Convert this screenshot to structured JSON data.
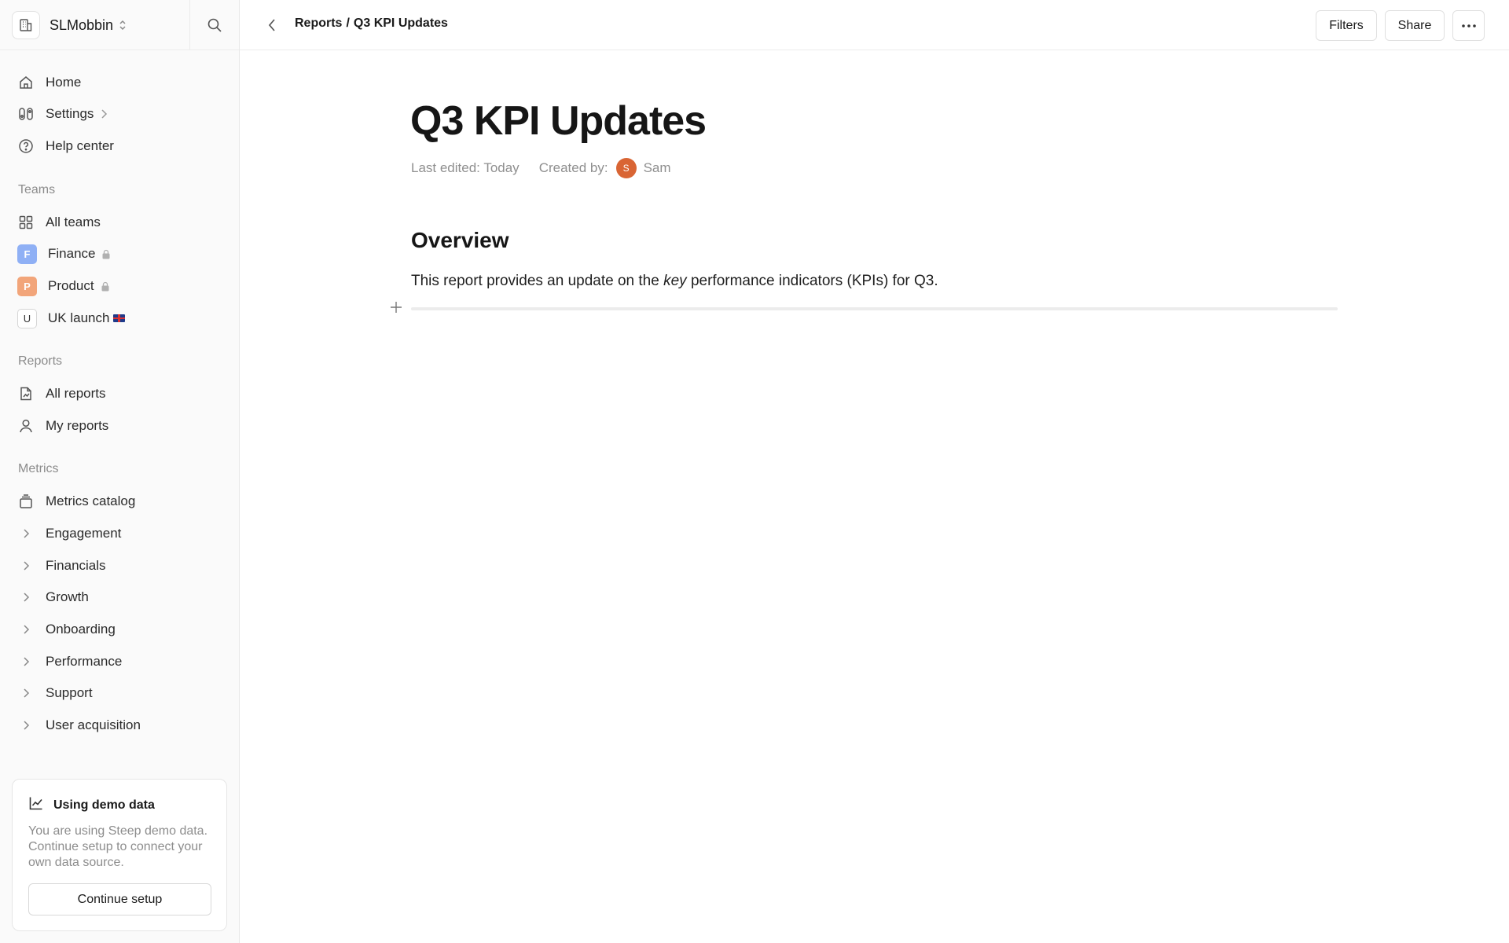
{
  "workspace": {
    "name": "SLMobbin"
  },
  "sidebar": {
    "nav": [
      {
        "label": "Home",
        "icon": "home-icon"
      },
      {
        "label": "Settings",
        "icon": "settings-icon"
      },
      {
        "label": "Help center",
        "icon": "help-icon"
      }
    ],
    "teams_label": "Teams",
    "teams": [
      {
        "label": "All teams",
        "icon": "grid-icon"
      },
      {
        "label": "Finance",
        "badge": "F",
        "badge_color": "#8fb0f5",
        "locked": true
      },
      {
        "label": "Product",
        "badge": "P",
        "badge_color": "#f2a57a",
        "locked": true
      },
      {
        "label": "UK launch",
        "badge": "U",
        "flag": "uk-flag-icon"
      }
    ],
    "reports_label": "Reports",
    "reports": [
      {
        "label": "All reports",
        "icon": "report-icon"
      },
      {
        "label": "My reports",
        "icon": "user-icon"
      }
    ],
    "metrics_label": "Metrics",
    "metrics_catalog": {
      "label": "Metrics catalog",
      "icon": "catalog-icon"
    },
    "metric_groups": [
      {
        "label": "Engagement"
      },
      {
        "label": "Financials"
      },
      {
        "label": "Growth"
      },
      {
        "label": "Onboarding"
      },
      {
        "label": "Performance"
      },
      {
        "label": "Support"
      },
      {
        "label": "User acquisition"
      }
    ],
    "demo": {
      "title": "Using demo data",
      "description": "You are using Steep demo data. Continue setup to connect your own data source.",
      "button": "Continue setup"
    }
  },
  "topbar": {
    "breadcrumb_parent": "Reports",
    "breadcrumb_separator": "/",
    "breadcrumb_current": "Q3 KPI Updates",
    "filters_label": "Filters",
    "share_label": "Share"
  },
  "document": {
    "title": "Q3 KPI Updates",
    "last_edited": "Last edited: Today",
    "created_by_label": "Created by:",
    "author_initial": "S",
    "author_name": "Sam",
    "author_color": "#d96534",
    "section_heading": "Overview",
    "paragraph_before": "This report provides an update on the ",
    "paragraph_emphasis": "key",
    "paragraph_after": " performance indicators (KPIs) for Q3."
  }
}
